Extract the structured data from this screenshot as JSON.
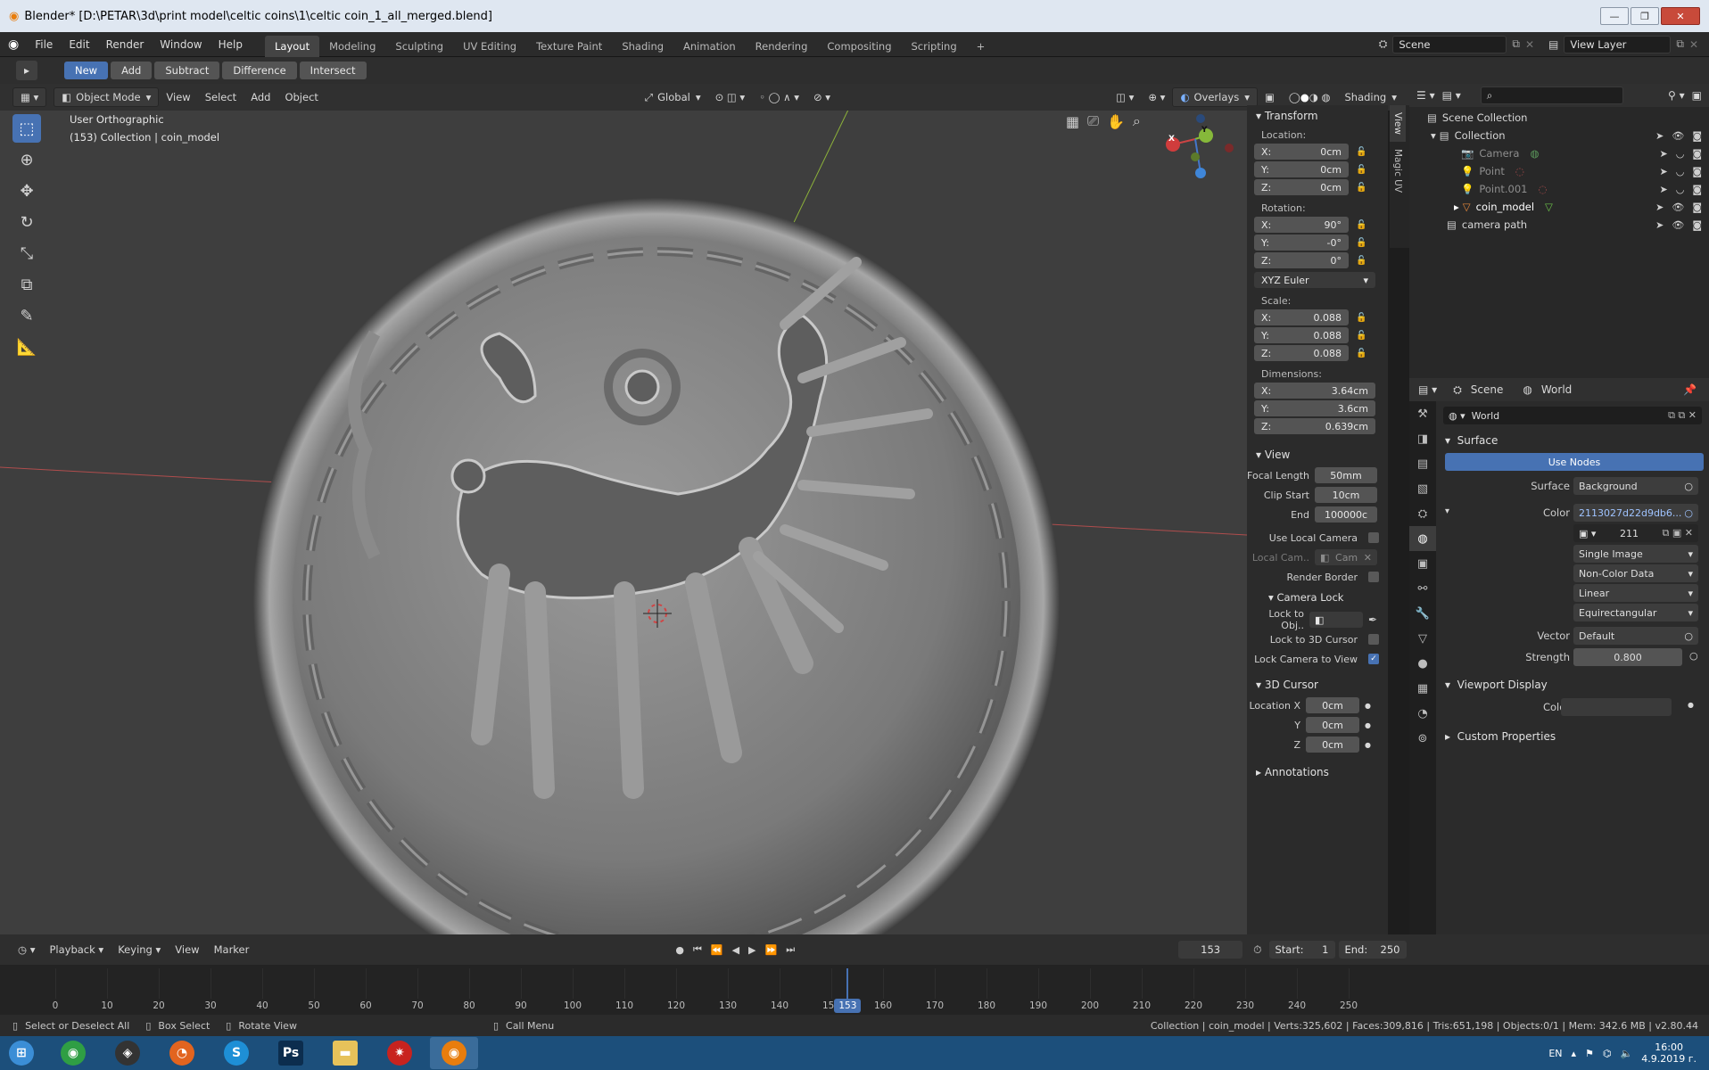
{
  "window": {
    "title": "Blender* [D:\\PETAR\\3d\\print model\\celtic coins\\1\\celtic coin_1_all_merged.blend]",
    "min": "—",
    "max": "❐",
    "close": "✕"
  },
  "menu": [
    "File",
    "Edit",
    "Render",
    "Window",
    "Help"
  ],
  "workspaces": [
    "Layout",
    "Modeling",
    "Sculpting",
    "UV Editing",
    "Texture Paint",
    "Shading",
    "Animation",
    "Rendering",
    "Compositing",
    "Scripting",
    "+"
  ],
  "scene": {
    "name": "Scene",
    "view_layer": "View Layer"
  },
  "bool_tools": {
    "new": "New",
    "add": "Add",
    "subtract": "Subtract",
    "difference": "Difference",
    "intersect": "Intersect"
  },
  "vheader": {
    "mode": "Object Mode",
    "view": "View",
    "select": "Select",
    "add": "Add",
    "object": "Object",
    "orientation": "Global",
    "overlays": "Overlays",
    "shading": "Shading"
  },
  "viewport": {
    "view_name": "User Orthographic",
    "collection_info": "(153) Collection | coin_model",
    "side_tab_view": "View",
    "side_tab_magic": "Magic UV"
  },
  "gizmo": {
    "x": "X",
    "y": "Y"
  },
  "transform": {
    "title": "Transform",
    "location_label": "Location:",
    "location": [
      {
        "axis": "X:",
        "value": "0cm"
      },
      {
        "axis": "Y:",
        "value": "0cm"
      },
      {
        "axis": "Z:",
        "value": "0cm"
      }
    ],
    "rotation_label": "Rotation:",
    "rotation": [
      {
        "axis": "X:",
        "value": "90°"
      },
      {
        "axis": "Y:",
        "value": "-0°"
      },
      {
        "axis": "Z:",
        "value": "0°"
      }
    ],
    "rotation_mode": "XYZ Euler",
    "scale_label": "Scale:",
    "scale": [
      {
        "axis": "X:",
        "value": "0.088"
      },
      {
        "axis": "Y:",
        "value": "0.088"
      },
      {
        "axis": "Z:",
        "value": "0.088"
      }
    ],
    "dimensions_label": "Dimensions:",
    "dimensions": [
      {
        "axis": "X:",
        "value": "3.64cm"
      },
      {
        "axis": "Y:",
        "value": "3.6cm"
      },
      {
        "axis": "Z:",
        "value": "0.639cm"
      }
    ]
  },
  "view_panel": {
    "title": "View",
    "focal_length_label": "Focal Length",
    "focal_length": "50mm",
    "clip_start_label": "Clip Start",
    "clip_start": "10cm",
    "end_label": "End",
    "end": "100000c",
    "use_local_camera": "Use Local Camera",
    "local_camera_label": "Local Cam..",
    "local_camera_value": "Cam",
    "render_border": "Render Border",
    "camera_lock": "Camera Lock",
    "lock_to_obj": "Lock to Obj..",
    "lock_to_cursor": "Lock to 3D Cursor",
    "lock_camera_to_view": "Lock Camera to View"
  },
  "cursor_panel": {
    "title": "3D Cursor",
    "loc_x_label": "Location X",
    "y_label": "Y",
    "z_label": "Z",
    "x": "0cm",
    "y": "0cm",
    "z": "0cm"
  },
  "annotations": "Annotations",
  "outliner": {
    "root": "Scene Collection",
    "collection": "Collection",
    "items": [
      "Camera",
      "Point",
      "Point.001",
      "coin_model"
    ],
    "camera_path": "camera path"
  },
  "props_header": {
    "scene": "Scene",
    "world": "World"
  },
  "world": {
    "name": "World",
    "surface_section": "Surface",
    "use_nodes": "Use Nodes",
    "surface_label": "Surface",
    "surface_value": "Background",
    "color_label": "Color",
    "color_value": "2113027d22d9db6...",
    "image_users": "211",
    "source": "Single Image",
    "colorspace": "Non-Color Data",
    "interpolation": "Linear",
    "projection": "Equirectangular",
    "vector_label": "Vector",
    "vector_value": "Default",
    "strength_label": "Strength",
    "strength_value": "0.800",
    "viewport_display": "Viewport Display",
    "vd_color_label": "Color",
    "custom_props": "Custom Properties"
  },
  "timeline": {
    "playback": "Playback",
    "keying": "Keying",
    "view": "View",
    "marker": "Marker",
    "current_frame": "153",
    "start_label": "Start:",
    "start": "1",
    "end_label": "End:",
    "end": "250",
    "ticks": [
      "0",
      "10",
      "20",
      "30",
      "40",
      "50",
      "60",
      "70",
      "80",
      "90",
      "100",
      "110",
      "120",
      "130",
      "140",
      "150",
      "160",
      "170",
      "180",
      "190",
      "200",
      "210",
      "220",
      "230",
      "240",
      "250"
    ],
    "playhead": "153"
  },
  "statusbar": {
    "select": "Select or Deselect All",
    "box": "Box Select",
    "rotate": "Rotate View",
    "call_menu": "Call Menu",
    "stats": "Collection | coin_model | Verts:325,602 | Faces:309,816 | Tris:651,198 | Objects:0/1 | Mem: 342.6 MB | v2.80.44"
  },
  "taskbar": {
    "lang": "EN",
    "time": "16:00",
    "date": "4.9.2019 г."
  },
  "colors": {
    "accent": "#4772b3",
    "viewport_bg": "#3e3e3e",
    "x_axis": "#c84a4a",
    "y_axis": "#8dba3a"
  }
}
